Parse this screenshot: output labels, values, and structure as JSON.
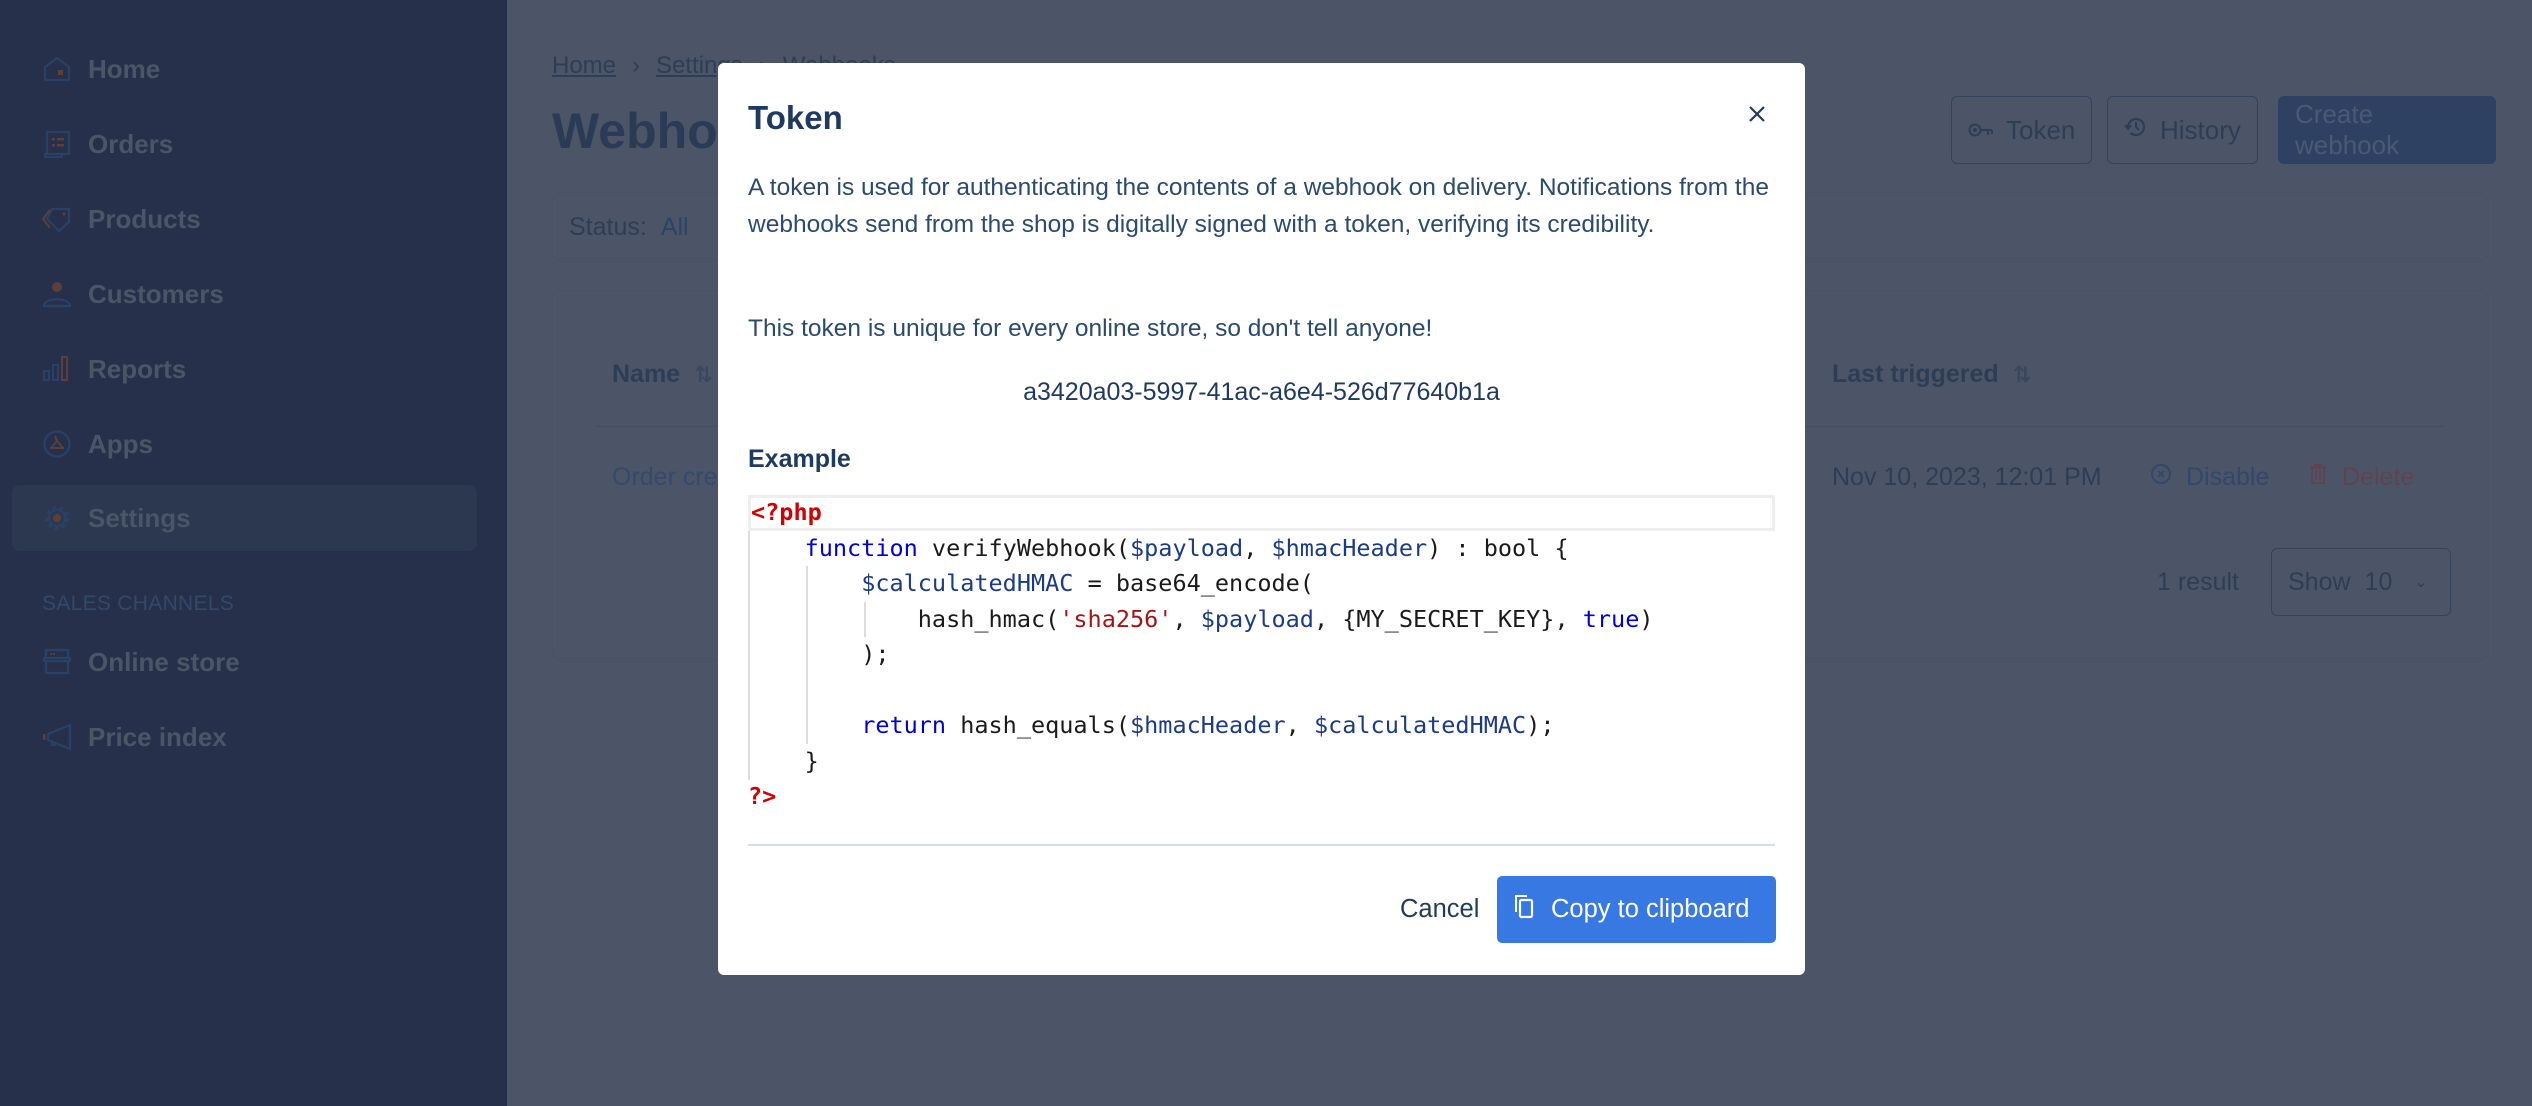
{
  "sidebar": {
    "items": [
      {
        "label": "Home",
        "icon": "home-icon"
      },
      {
        "label": "Orders",
        "icon": "orders-icon"
      },
      {
        "label": "Products",
        "icon": "tag-icon"
      },
      {
        "label": "Customers",
        "icon": "person-icon"
      },
      {
        "label": "Reports",
        "icon": "bar-chart-icon"
      },
      {
        "label": "Apps",
        "icon": "apps-icon"
      },
      {
        "label": "Settings",
        "icon": "gear-icon",
        "active": true
      }
    ],
    "section_title": "SALES CHANNELS",
    "channels": [
      {
        "label": "Online store",
        "icon": "store-icon"
      },
      {
        "label": "Price index",
        "icon": "megaphone-icon"
      }
    ]
  },
  "page": {
    "breadcrumb": [
      "Home",
      "Settings",
      "Webhooks"
    ],
    "title": "Webhooks",
    "buttons": {
      "token": "Token",
      "history": "History",
      "create": "Create webhook"
    },
    "filter": {
      "label": "Status:",
      "value": "All"
    },
    "table": {
      "columns": [
        "Name",
        "Last triggered"
      ],
      "rows": [
        {
          "name": "Order created",
          "last_triggered": "Nov 10, 2023, 12:01 PM",
          "actions": [
            "Disable",
            "Delete"
          ]
        }
      ]
    },
    "result_count": "1 result",
    "page_size": {
      "label": "Show",
      "value": "10"
    }
  },
  "modal": {
    "title": "Token",
    "description": "A token is used for authenticating the contents of a webhook on delivery. Notifications from the webhooks send from the shop is digitally signed with a token, verifying its credibility.",
    "warning": "This token is unique for every online store, so don't tell anyone!",
    "token": "a3420a03-5997-41ac-a6e4-526d77640b1a",
    "example_label": "Example",
    "code": {
      "open_tag": "<?php",
      "l1_kw": "function",
      "l1_fn": " verifyWebhook(",
      "l1_v1": "$payload",
      "l1_sep": ", ",
      "l1_v2": "$hmacHeader",
      "l1_end": ") : bool {",
      "l2_var": "$calculatedHMAC",
      "l2_rest": " = base64_encode(",
      "l3_fn": "hash_hmac(",
      "l3_str": "'sha256'",
      "l3_sep": ", ",
      "l3_var": "$payload",
      "l3_mid": ", {MY_SECRET_KEY}, ",
      "l3_kw": "true",
      "l3_end": ")",
      "l4": ");",
      "l6_kw": "return",
      "l6_fn": " hash_equals(",
      "l6_v1": "$hmacHeader",
      "l6_sep": ", ",
      "l6_v2": "$calculatedHMAC",
      "l6_end": ");",
      "l7": "}",
      "close_tag": "?>"
    },
    "cancel_label": "Cancel",
    "copy_label": "Copy to clipboard"
  },
  "colors": {
    "primary": "#3878e3",
    "overlay_bg": "#4b5567",
    "sidebar_bg": "#27304a"
  }
}
